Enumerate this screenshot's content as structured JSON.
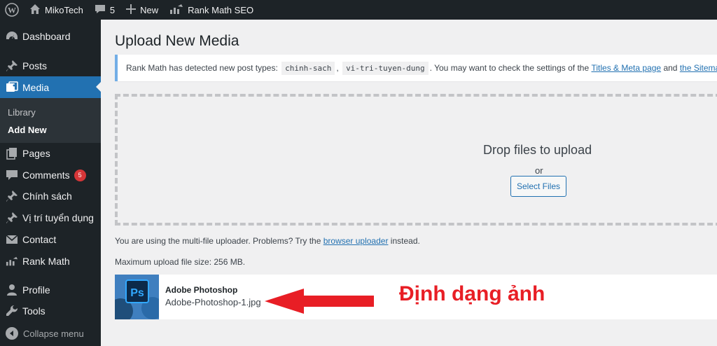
{
  "adminbar": {
    "site_name": "MikoTech",
    "comments_count": "5",
    "new_label": "New",
    "seo_label": "Rank Math SEO"
  },
  "sidebar": {
    "items": [
      {
        "label": "Dashboard",
        "icon": "dashboard-icon"
      },
      {
        "label": "Posts",
        "icon": "pin-icon"
      },
      {
        "label": "Media",
        "icon": "media-icon",
        "current": true
      },
      {
        "label": "Pages",
        "icon": "pages-icon"
      },
      {
        "label": "Comments",
        "icon": "comment-icon",
        "badge": "5"
      },
      {
        "label": "Chính sách",
        "icon": "pin-icon"
      },
      {
        "label": "Vị trí tuyển dụng",
        "icon": "pin-icon"
      },
      {
        "label": "Contact",
        "icon": "mail-icon"
      },
      {
        "label": "Rank Math",
        "icon": "chart-icon"
      },
      {
        "label": "Profile",
        "icon": "user-icon"
      },
      {
        "label": "Tools",
        "icon": "wrench-icon"
      }
    ],
    "submenu": [
      "Library",
      "Add New"
    ],
    "collapse_label": "Collapse menu"
  },
  "main": {
    "title": "Upload New Media",
    "notice": {
      "prefix": "Rank Math has detected new post types:",
      "code1": "chinh-sach",
      "sep": ",",
      "code2": "vi-tri-tuyen-dung",
      "middle": ". You may want to check the settings of the",
      "link1": "Titles & Meta page",
      "and": "and",
      "link2": "the Sitemap",
      "end": "."
    },
    "dropzone": {
      "title": "Drop files to upload",
      "or": "or",
      "button": "Select Files"
    },
    "uploader_info": {
      "prefix": "You are using the multi-file uploader. Problems? Try the",
      "link": "browser uploader",
      "suffix": "instead."
    },
    "max_size": "Maximum upload file size: 256 MB.",
    "media_item": {
      "name": "Adobe Photoshop",
      "file": "Adobe-Photoshop-1.jpg",
      "thumb_text": "Ps"
    },
    "annotation": "Định dạng ảnh"
  },
  "colors": {
    "accent": "#2271b1",
    "sidebar_bg": "#1d2327",
    "annotation": "#e81e25"
  }
}
